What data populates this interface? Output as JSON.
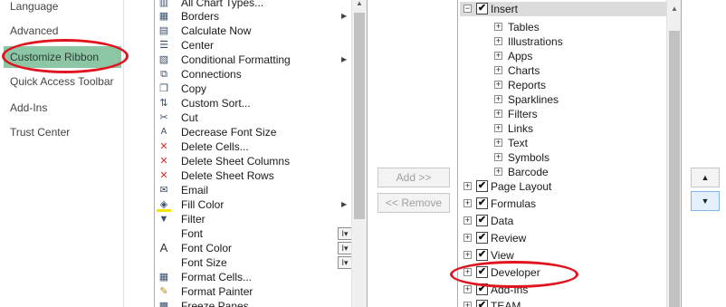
{
  "nav": {
    "items": [
      {
        "label": "Language"
      },
      {
        "label": "Advanced"
      },
      {
        "label": "Customize Ribbon"
      },
      {
        "label": "Quick Access Toolbar"
      },
      {
        "label": "Add-Ins"
      },
      {
        "label": "Trust Center"
      }
    ],
    "selected": "Customize Ribbon"
  },
  "commands": [
    {
      "label": "All Chart Types...",
      "icon": "chart-icon"
    },
    {
      "label": "Borders",
      "icon": "borders-icon",
      "submenu": true
    },
    {
      "label": "Calculate Now",
      "icon": "calculator-icon"
    },
    {
      "label": "Center",
      "icon": "align-center-icon"
    },
    {
      "label": "Conditional Formatting",
      "icon": "conditional-formatting-icon",
      "submenu": true
    },
    {
      "label": "Connections",
      "icon": "connections-icon"
    },
    {
      "label": "Copy",
      "icon": "copy-icon"
    },
    {
      "label": "Custom Sort...",
      "icon": "sort-icon"
    },
    {
      "label": "Cut",
      "icon": "scissors-icon"
    },
    {
      "label": "Decrease Font Size",
      "icon": "decrease-font-icon"
    },
    {
      "label": "Delete Cells...",
      "icon": "delete-cells-icon"
    },
    {
      "label": "Delete Sheet Columns",
      "icon": "delete-columns-icon"
    },
    {
      "label": "Delete Sheet Rows",
      "icon": "delete-rows-icon"
    },
    {
      "label": "Email",
      "icon": "email-icon"
    },
    {
      "label": "Fill Color",
      "icon": "fill-color-icon",
      "submenu": true
    },
    {
      "label": "Filter",
      "icon": "filter-icon"
    },
    {
      "label": "Font",
      "icon": "",
      "combo": true
    },
    {
      "label": "Font Color",
      "icon": "font-color-icon",
      "combo": true
    },
    {
      "label": "Font Size",
      "icon": "",
      "combo": true
    },
    {
      "label": "Format Cells...",
      "icon": "format-cells-icon"
    },
    {
      "label": "Format Painter",
      "icon": "format-painter-icon"
    },
    {
      "label": "Freeze Panes",
      "icon": "freeze-panes-icon"
    }
  ],
  "buttons": {
    "add": "Add >>",
    "remove": "<< Remove"
  },
  "ribbon_tree": {
    "insert": {
      "label": "Insert",
      "checked": true,
      "expanded": true,
      "children": [
        "Tables",
        "Illustrations",
        "Apps",
        "Charts",
        "Reports",
        "Sparklines",
        "Filters",
        "Links",
        "Text",
        "Symbols",
        "Barcode"
      ]
    },
    "tabs": [
      {
        "label": "Page Layout",
        "checked": true
      },
      {
        "label": "Formulas",
        "checked": true
      },
      {
        "label": "Data",
        "checked": true
      },
      {
        "label": "Review",
        "checked": true
      },
      {
        "label": "View",
        "checked": true
      },
      {
        "label": "Developer",
        "checked": true
      },
      {
        "label": "Add-Ins",
        "checked": true
      },
      {
        "label": "TEAM",
        "checked": true
      }
    ]
  },
  "glyphs": {
    "plus": "+",
    "minus": "−",
    "check": "✔",
    "submenu_arrow": "▶",
    "combo_arrow": "I▾",
    "scroll_up": "▲",
    "scroll_down": "▼",
    "move_up": "▲",
    "move_down": "▼"
  },
  "colors": {
    "selected_nav": "#8cc6a4",
    "annotation": "#e0141e",
    "tree_highlight": "#dcdcdc"
  }
}
